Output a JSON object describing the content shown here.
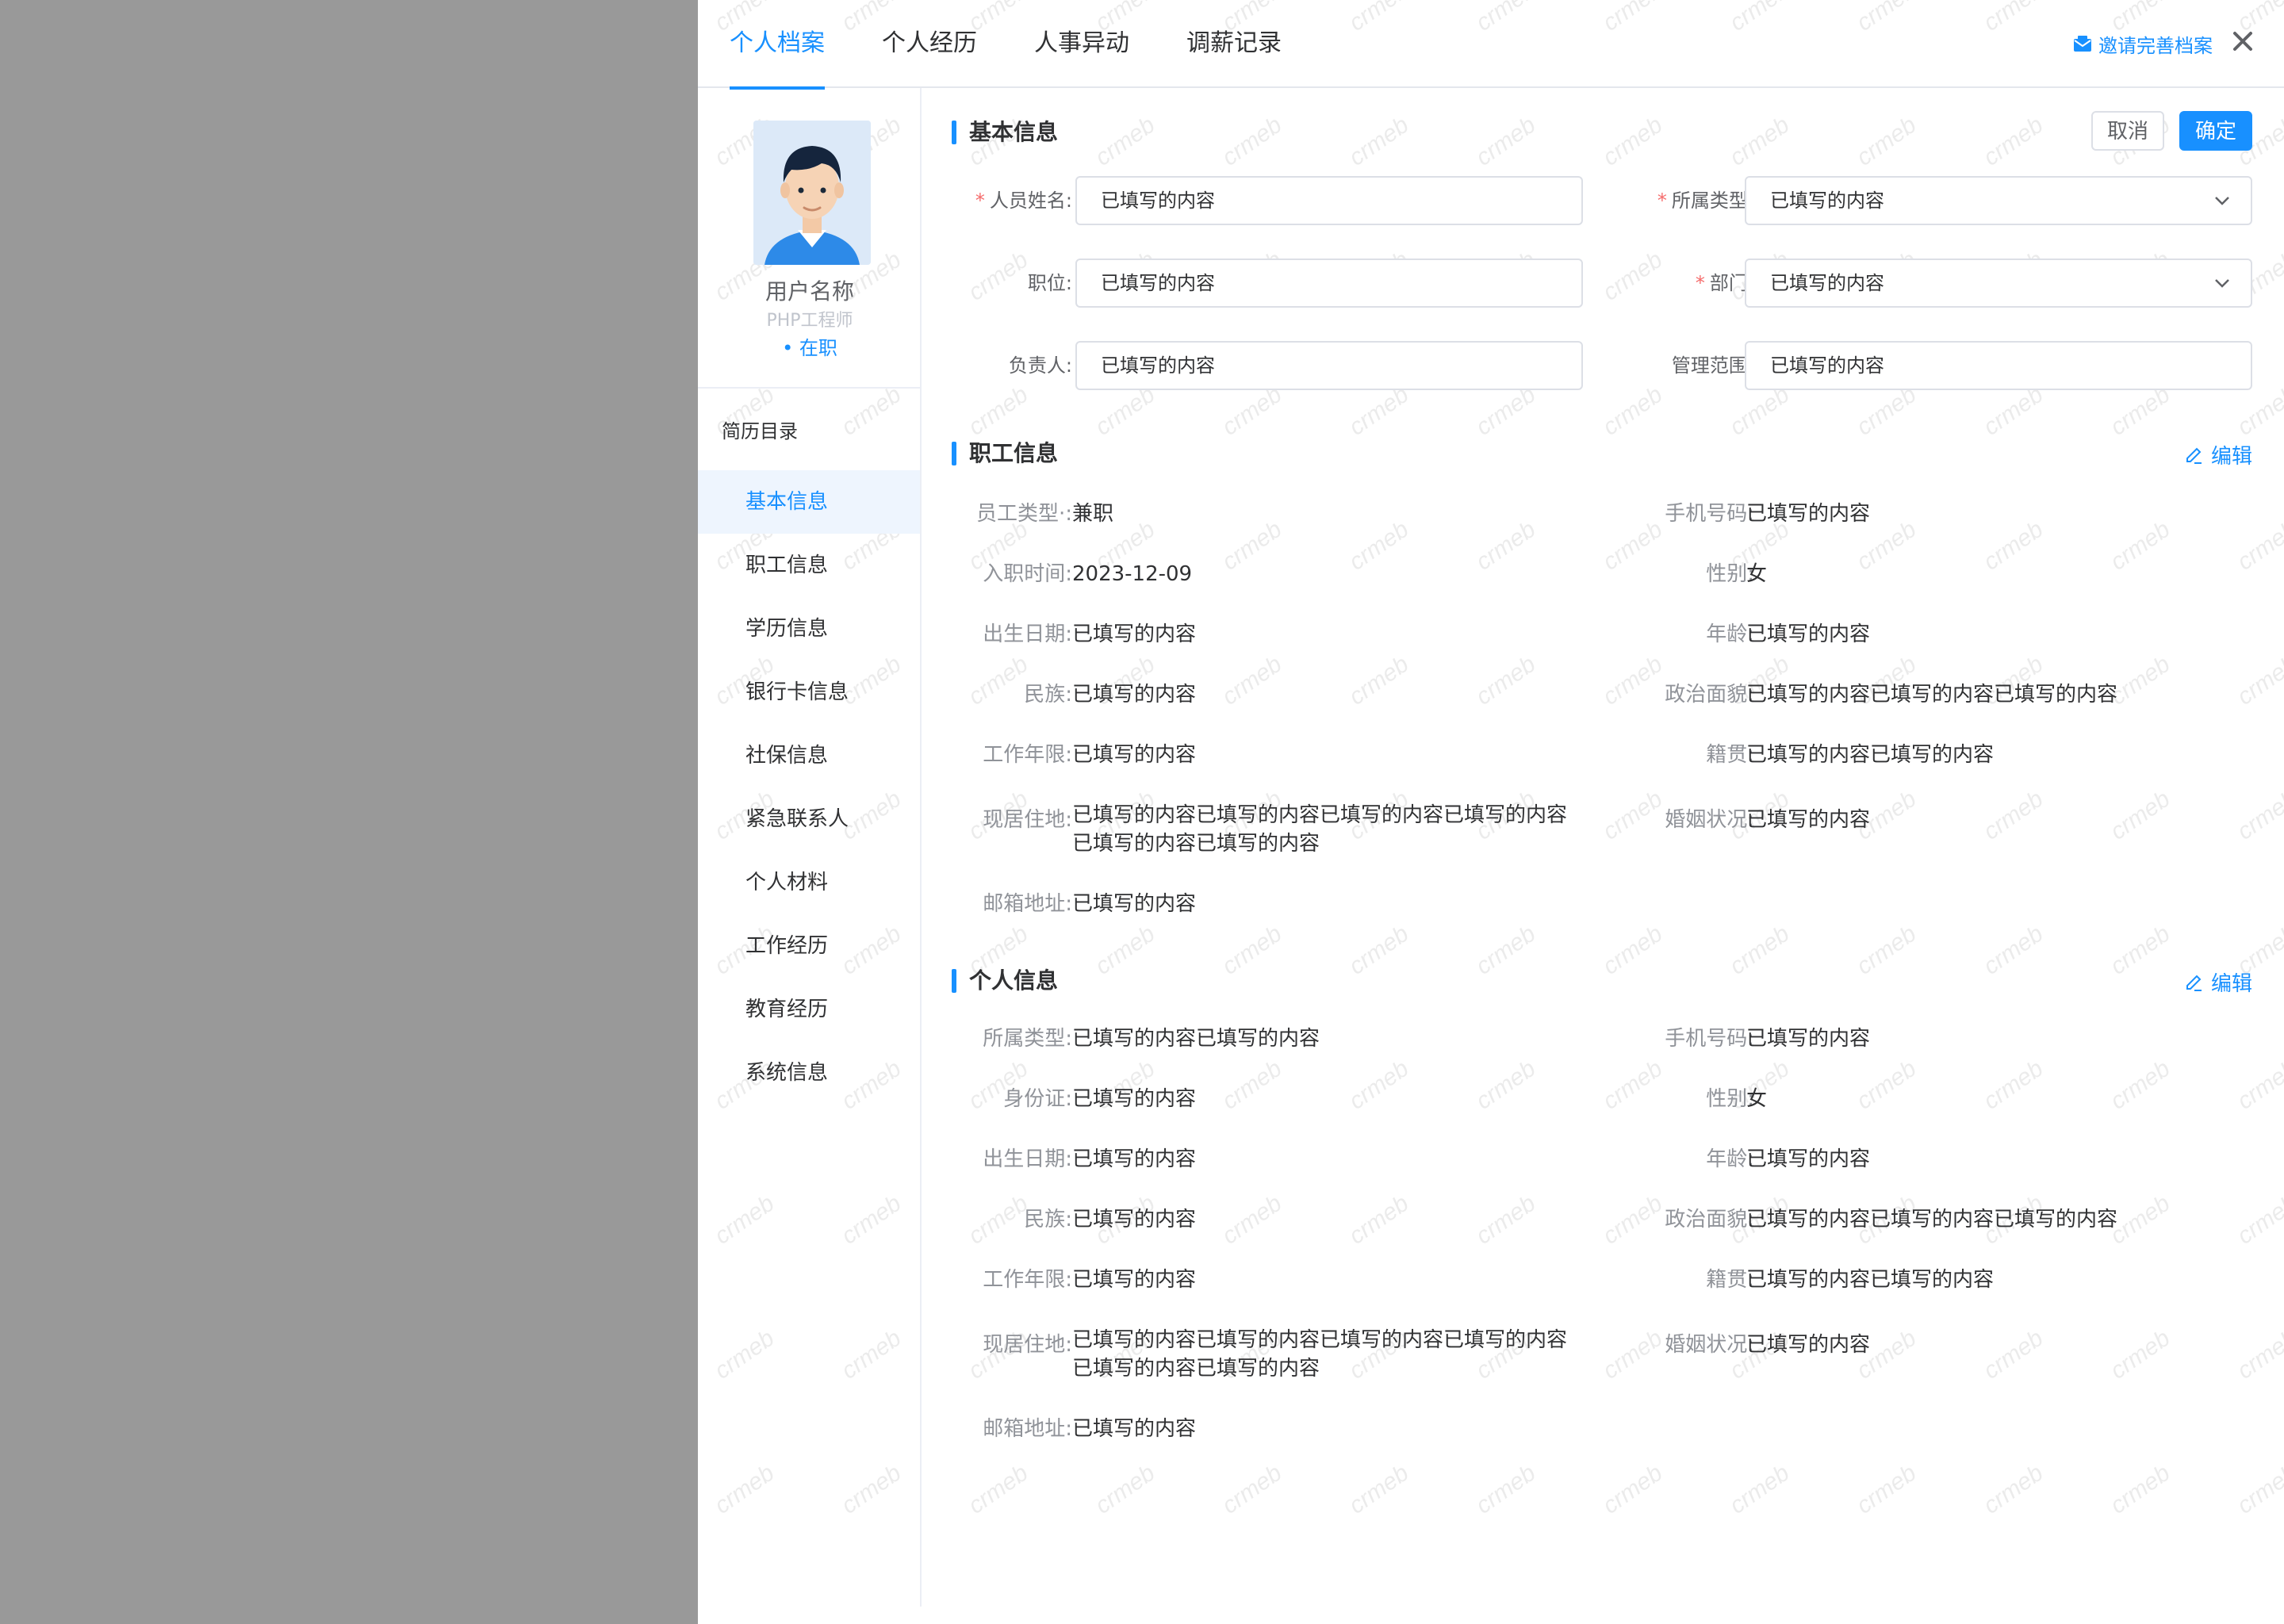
{
  "tabs": [
    "个人档案",
    "个人经历",
    "人事异动",
    "调薪记录"
  ],
  "header": {
    "invite_label": "邀请完善档案"
  },
  "profile": {
    "name": "用户名称",
    "role": "PHP工程师",
    "status": "• 在职"
  },
  "toc": {
    "title": "简历目录",
    "items": [
      "基本信息",
      "职工信息",
      "学历信息",
      "银行卡信息",
      "社保信息",
      "紧急联系人",
      "个人材料",
      "工作经历",
      "教育经历",
      "系统信息"
    ]
  },
  "basic": {
    "title": "基本信息",
    "cancel": "取消",
    "confirm": "确定",
    "fields": {
      "name_label": "人员姓名:",
      "name_value": "已填写的内容",
      "type_label": "所属类型:",
      "type_value": "已填写的内容",
      "position_label": "职位:",
      "position_value": "已填写的内容",
      "dept_label": "部门:",
      "dept_value": "已填写的内容",
      "leader_label": "负责人:",
      "leader_value": "已填写的内容",
      "scope_label": "管理范围:",
      "scope_value": "已填写的内容"
    }
  },
  "staff": {
    "title": "职工信息",
    "edit": "编辑",
    "rows": [
      {
        "ll": "员工类型·:",
        "lv": "兼职",
        "rl": "手机号码:",
        "rv": "已填写的内容"
      },
      {
        "ll": "入职时间:",
        "lv": "2023-12-09",
        "rl": "性别:",
        "rv": "女"
      },
      {
        "ll": "出生日期:",
        "lv": "已填写的内容",
        "rl": "年龄:",
        "rv": "已填写的内容"
      },
      {
        "ll": "民族:",
        "lv": "已填写的内容",
        "rl": "政治面貌:",
        "rv": "已填写的内容已填写的内容已填写的内容"
      },
      {
        "ll": "工作年限:",
        "lv": "已填写的内容",
        "rl": "籍贯:",
        "rv": "已填写的内容已填写的内容"
      },
      {
        "ll": "现居住地:",
        "lv": "已填写的内容已填写的内容已填写的内容已填写的内容",
        "lv2": "已填写的内容已填写的内容",
        "rl": "婚姻状况:",
        "rv": "已填写的内容"
      },
      {
        "ll": "邮箱地址:",
        "lv": "已填写的内容"
      }
    ]
  },
  "personal": {
    "title": "个人信息",
    "edit": "编辑",
    "rows": [
      {
        "ll": "所属类型:",
        "lv": "已填写的内容已填写的内容",
        "rl": "手机号码:",
        "rv": "已填写的内容"
      },
      {
        "ll": "身份证:",
        "lv": "已填写的内容",
        "rl": "性别:",
        "rv": "女"
      },
      {
        "ll": "出生日期:",
        "lv": "已填写的内容",
        "rl": "年龄:",
        "rv": "已填写的内容"
      },
      {
        "ll": "民族:",
        "lv": "已填写的内容",
        "rl": "政治面貌:",
        "rv": "已填写的内容已填写的内容已填写的内容"
      },
      {
        "ll": "工作年限:",
        "lv": "已填写的内容",
        "rl": "籍贯:",
        "rv": "已填写的内容已填写的内容"
      },
      {
        "ll": "现居住地:",
        "lv": "已填写的内容已填写的内容已填写的内容已填写的内容",
        "lv2": "已填写的内容已填写的内容",
        "rl": "婚姻状况:",
        "rv": "已填写的内容"
      },
      {
        "ll": "邮箱地址:",
        "lv": "已填写的内容"
      }
    ]
  },
  "watermark_text": "crmeb",
  "colors": {
    "accent": "#1890ff",
    "required": "#f56c6c",
    "overlay": "#999999"
  }
}
